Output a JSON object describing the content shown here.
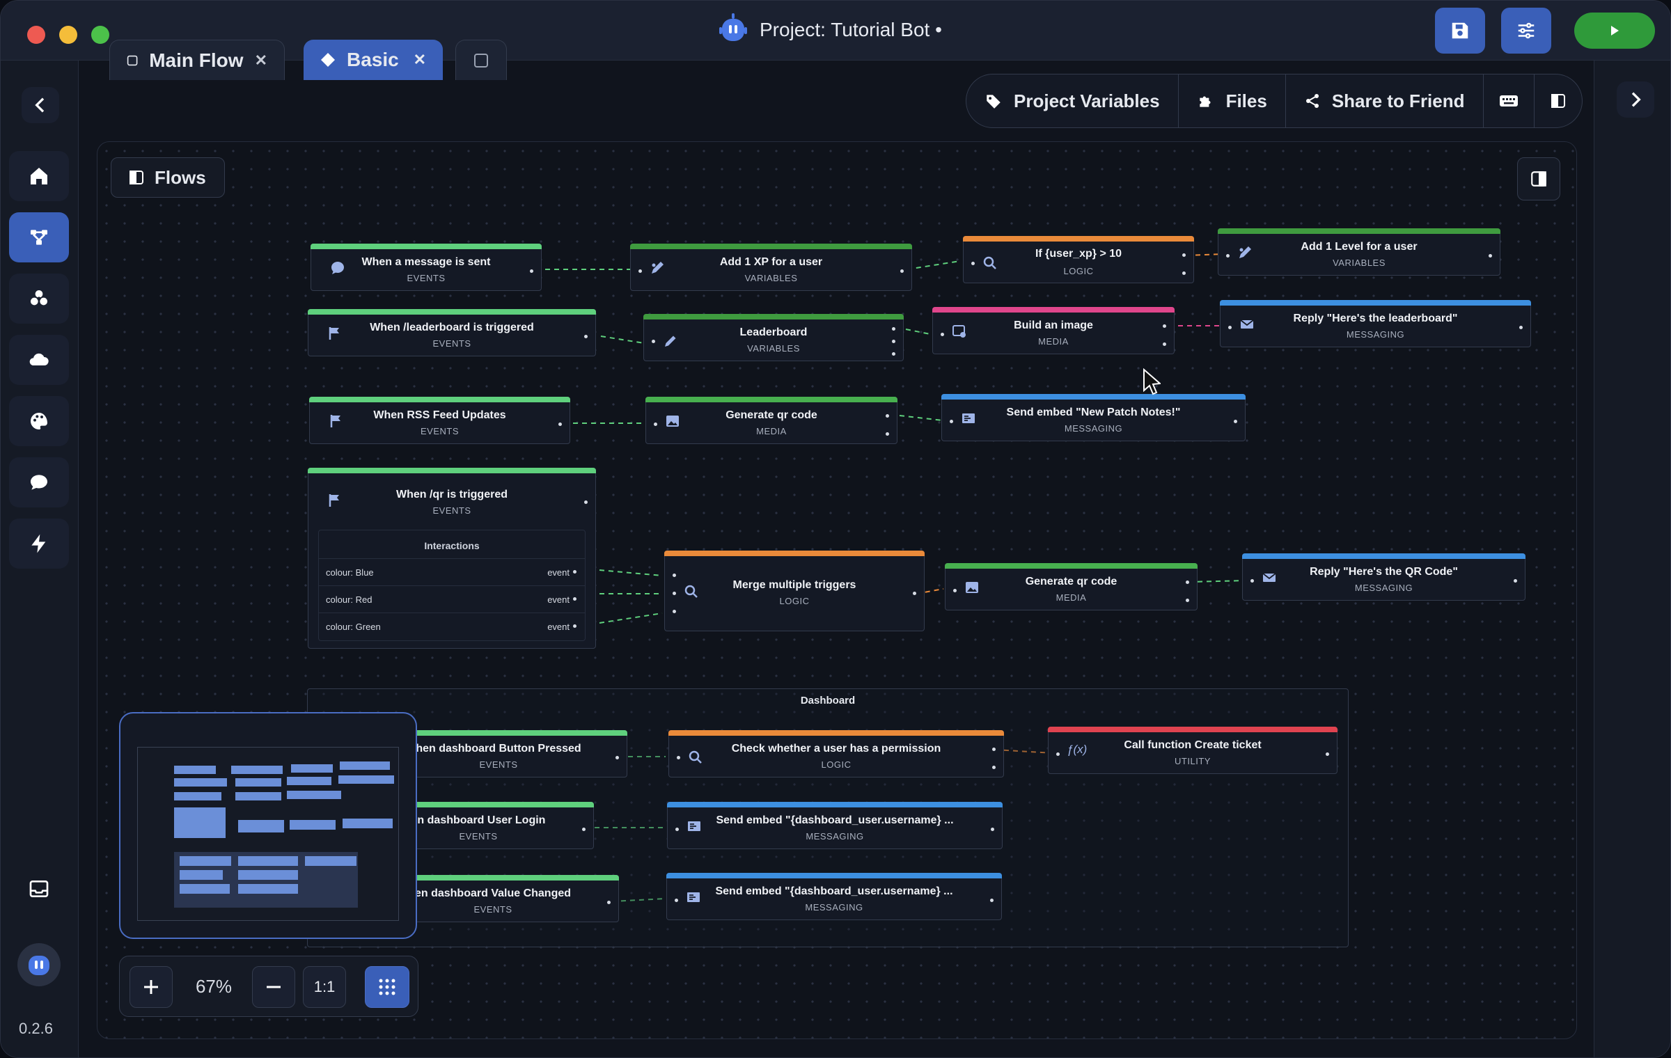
{
  "window": {
    "title": "Project: Tutorial Bot •"
  },
  "colors": {
    "events": "#5fd07d",
    "variables": "#3f9b3f",
    "logic": "#ea8a3a",
    "media": "#48b04f",
    "messaging": "#3d8fe0",
    "image": "#e0468c",
    "utility": "#e04350",
    "accent": "#3a5fb8",
    "run": "#2f9a3a"
  },
  "toolbar": {
    "save_icon": "save-icon",
    "settings_icon": "sliders-icon",
    "run_icon": "play-icon"
  },
  "sidebar": {
    "items": [
      {
        "icon": "home-icon"
      },
      {
        "icon": "flow-icon"
      },
      {
        "icon": "modules-icon"
      },
      {
        "icon": "cloud-icon"
      },
      {
        "icon": "palette-icon"
      },
      {
        "icon": "chat-icon"
      },
      {
        "icon": "bolt-icon"
      }
    ],
    "inbox_icon": "inbox-icon",
    "version": "0.2.6"
  },
  "tabs": [
    {
      "label": "Main Flow"
    },
    {
      "label": "Basic"
    }
  ],
  "topbar": {
    "project_variables": "Project Variables",
    "files": "Files",
    "share": "Share to Friend"
  },
  "flows_button": "Flows",
  "nodes": {
    "msg_sent": {
      "title": "When a message is sent",
      "category": "EVENTS"
    },
    "add_xp": {
      "title": "Add 1 XP for a user",
      "category": "VARIABLES"
    },
    "if_xp": {
      "title": "If {user_xp} > 10",
      "category": "LOGIC"
    },
    "add_level": {
      "title": "Add 1 Level for a user",
      "category": "VARIABLES"
    },
    "leaderboard_trig": {
      "title": "When /leaderboard is triggered",
      "category": "EVENTS"
    },
    "leaderboard_var": {
      "title": "Leaderboard",
      "category": "VARIABLES"
    },
    "build_image": {
      "title": "Build an image",
      "category": "MEDIA"
    },
    "reply_leader": {
      "title": "Reply \"Here's the leaderboard\"",
      "category": "MESSAGING"
    },
    "rss": {
      "title": "When RSS Feed Updates",
      "category": "EVENTS"
    },
    "qr1": {
      "title": "Generate qr code",
      "category": "MEDIA"
    },
    "patch_embed": {
      "title": "Send embed \"New Patch Notes!\"",
      "category": "MESSAGING"
    },
    "qr_trig": {
      "title": "When /qr is triggered",
      "category": "EVENTS"
    },
    "merge": {
      "title": "Merge multiple triggers",
      "category": "LOGIC"
    },
    "qr2": {
      "title": "Generate qr code",
      "category": "MEDIA"
    },
    "reply_qr": {
      "title": "Reply \"Here's the QR Code\"",
      "category": "MESSAGING"
    },
    "dash_btn": {
      "title": "hen dashboard Button Pressed",
      "category": "EVENTS"
    },
    "check_perm": {
      "title": "Check whether a user has a permission",
      "category": "LOGIC"
    },
    "call_fn": {
      "title": "Call function Create ticket",
      "category": "UTILITY"
    },
    "dash_login": {
      "title": "en dashboard User Login",
      "category": "EVENTS"
    },
    "embed_user1": {
      "title": "Send embed \"{dashboard_user.username} ...",
      "category": "MESSAGING"
    },
    "dash_value": {
      "title": "en dashboard Value Changed",
      "category": "EVENTS"
    },
    "embed_user2": {
      "title": "Send embed \"{dashboard_user.username} ...",
      "category": "MESSAGING"
    }
  },
  "interactions": {
    "title": "Interactions",
    "rows": [
      {
        "label": "colour: Blue",
        "type": "event"
      },
      {
        "label": "colour: Red",
        "type": "event"
      },
      {
        "label": "colour: Green",
        "type": "event"
      }
    ]
  },
  "group": {
    "label": "Dashboard"
  },
  "zoom": {
    "level": "67%",
    "reset": "1:1"
  }
}
